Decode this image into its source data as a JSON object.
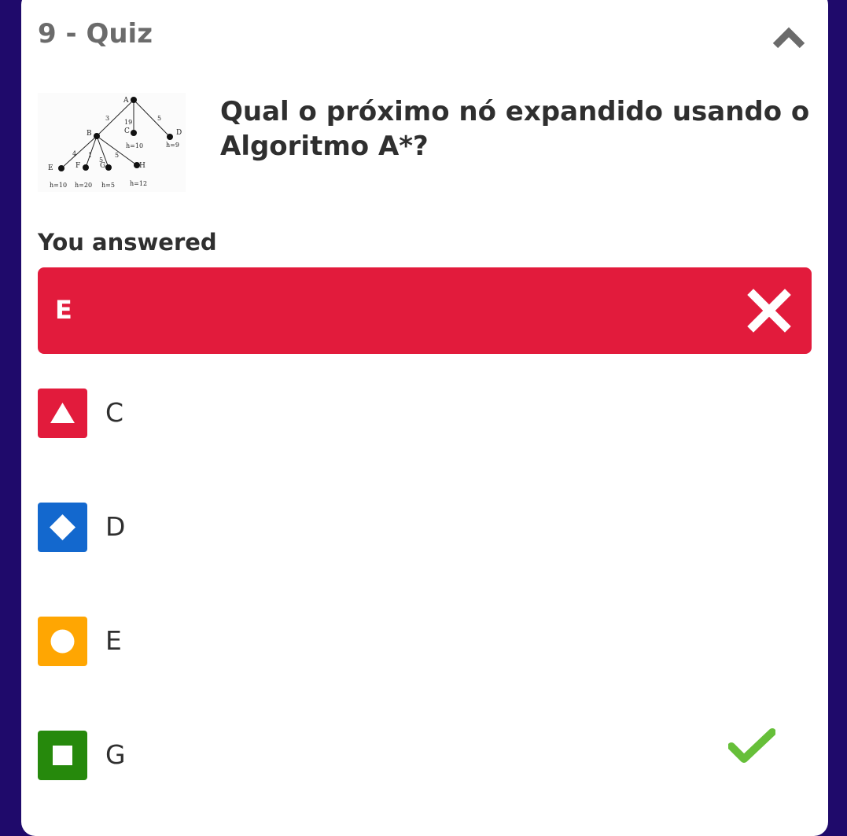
{
  "header": {
    "title": "9 - Quiz",
    "collapse_icon": "chevron-up-icon"
  },
  "question": {
    "text": "Qual o próximo nó expandido usando o Algoritmo A*?",
    "image": {
      "nodes": [
        "A",
        "B",
        "C",
        "D",
        "E",
        "F",
        "G",
        "H"
      ],
      "edge_costs": [
        "3",
        "19",
        "5",
        "4",
        "1",
        "5",
        "5"
      ],
      "heuristics": [
        "h=10",
        "h=9",
        "h=10",
        "h=20",
        "h=5",
        "h=12"
      ]
    }
  },
  "result": {
    "label": "You answered",
    "answer": "E",
    "status_icon": "close-icon",
    "color": "#e21b3c"
  },
  "options": [
    {
      "label": "C",
      "shape": "triangle-icon",
      "color": "#e21b3c",
      "correct": false
    },
    {
      "label": "D",
      "shape": "diamond-icon",
      "color": "#1368ce",
      "correct": false
    },
    {
      "label": "E",
      "shape": "circle-icon",
      "color": "#ffa602",
      "correct": false
    },
    {
      "label": "G",
      "shape": "square-icon",
      "color": "#26890c",
      "correct": true,
      "status_icon": "checkmark-icon"
    }
  ],
  "colors": {
    "background": "#1f0a6b",
    "card": "#ffffff",
    "correct_check": "#66bf39"
  }
}
